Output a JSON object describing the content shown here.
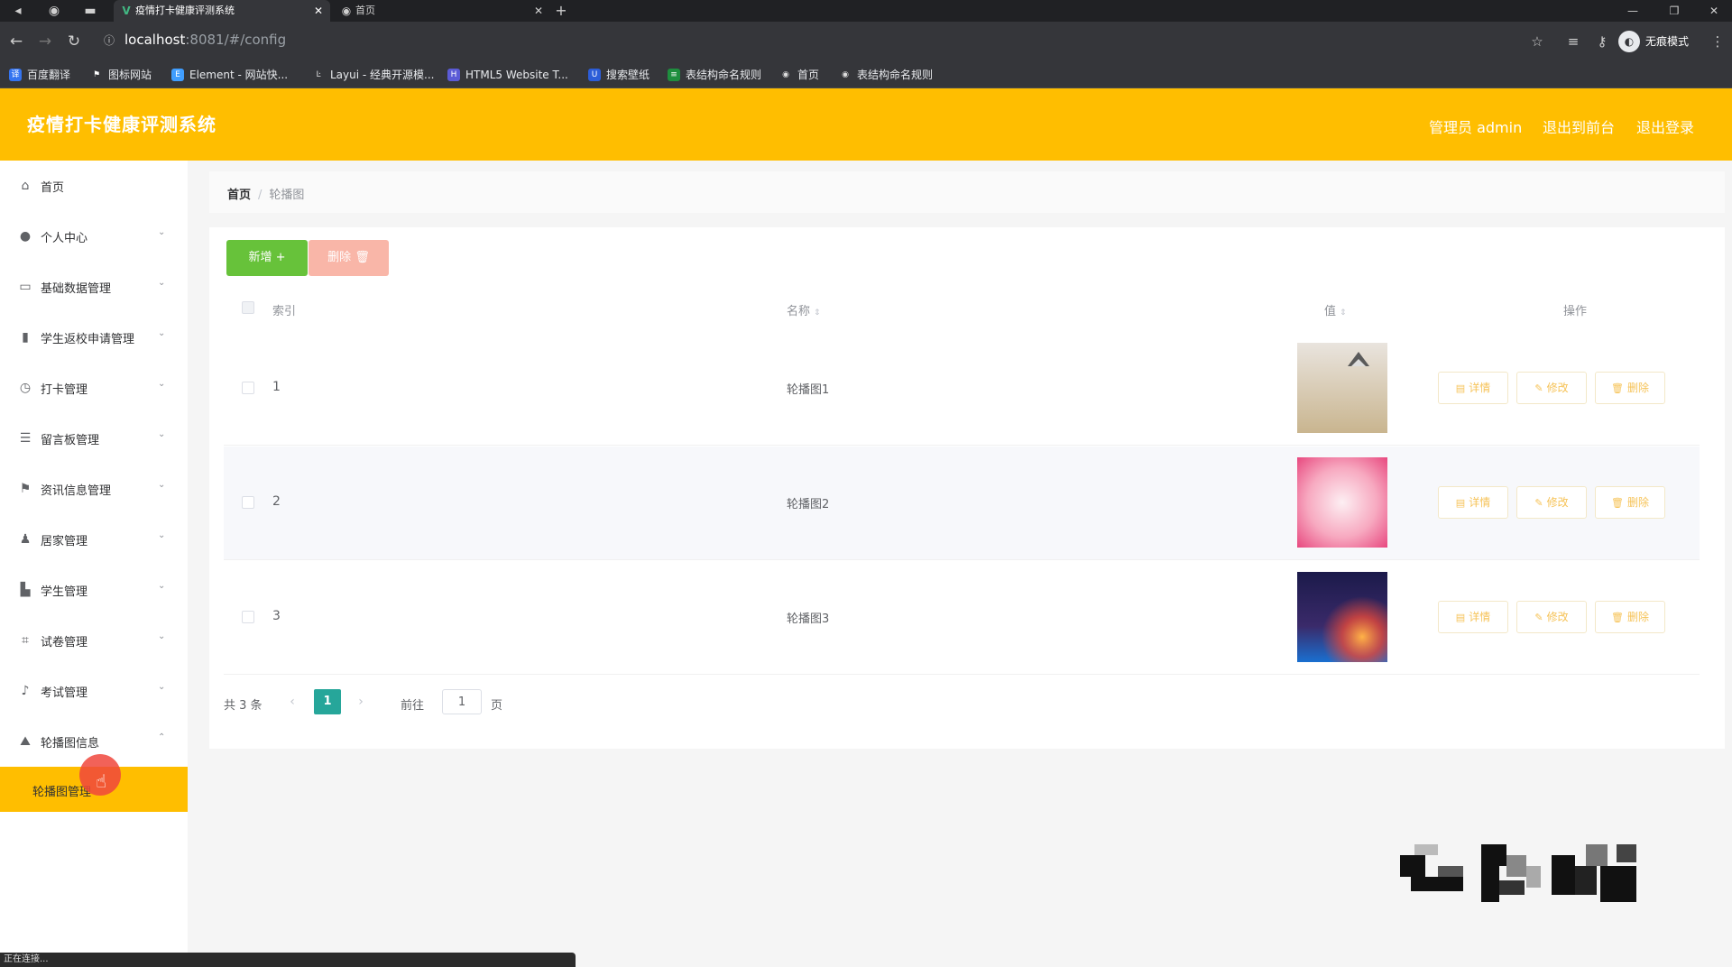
{
  "browser": {
    "tabs": [
      {
        "title": "疫情打卡健康评测系统",
        "active": true
      },
      {
        "title": "首页",
        "active": false
      }
    ],
    "url_host": "localhost",
    "url_path": ":8081/#/config",
    "profile": "无痕模式",
    "bookmarks": [
      "百度翻译",
      "图标网站",
      "Element - 网站快...",
      "Layui - 经典开源模...",
      "HTML5 Website T...",
      "搜索壁纸",
      "表结构命名规则",
      "首页",
      "表结构命名规则"
    ],
    "status_text": "正在连接..."
  },
  "header": {
    "title": "疫情打卡健康评测系统",
    "user": "管理员 admin",
    "front_link": "退出到前台",
    "logout_link": "退出登录"
  },
  "sidebar": {
    "items": [
      {
        "label": "首页",
        "icon": "home-icon"
      },
      {
        "label": "个人中心",
        "icon": "user-icon"
      },
      {
        "label": "基础数据管理",
        "icon": "card-icon"
      },
      {
        "label": "学生返校申请管理",
        "icon": "bar-chart-icon"
      },
      {
        "label": "打卡管理",
        "icon": "clock-icon"
      },
      {
        "label": "留言板管理",
        "icon": "list-icon"
      },
      {
        "label": "资讯信息管理",
        "icon": "flag-icon"
      },
      {
        "label": "居家管理",
        "icon": "person-icon"
      },
      {
        "label": "学生管理",
        "icon": "stamp-icon"
      },
      {
        "label": "试卷管理",
        "icon": "crop-icon"
      },
      {
        "label": "考试管理",
        "icon": "mic-icon"
      },
      {
        "label": "轮播图信息",
        "icon": "image-icon"
      }
    ],
    "active_sub": "轮播图管理"
  },
  "breadcrumb": {
    "home": "首页",
    "current": "轮播图"
  },
  "toolbar": {
    "add_label": "新增",
    "delete_label": "删除"
  },
  "table": {
    "headers": {
      "index": "索引",
      "name": "名称",
      "value": "值",
      "actions": "操作"
    },
    "rows": [
      {
        "index": "1",
        "name": "轮播图1"
      },
      {
        "index": "2",
        "name": "轮播图2"
      },
      {
        "index": "3",
        "name": "轮播图3"
      }
    ],
    "actions": {
      "detail": "详情",
      "edit": "修改",
      "delete": "删除"
    }
  },
  "pagination": {
    "total": "共 3 条",
    "current_page": "1",
    "goto_label": "前往",
    "goto_value": "1",
    "page_unit": "页"
  },
  "colors": {
    "brand": "#ffbe00",
    "add_button": "#67c23a",
    "delete_button": "#f9b6a8",
    "page_active": "#26a69a",
    "action_text": "#f6c358"
  }
}
